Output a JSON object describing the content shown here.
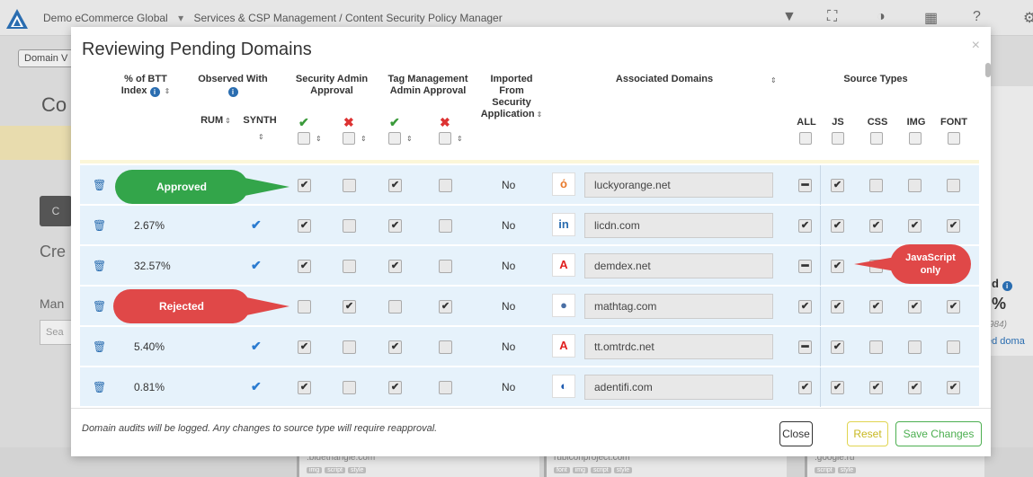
{
  "app": {
    "breadcrumb": [
      "Demo eCommerce Global",
      "Services & CSP Management / Content Security Policy Manager"
    ],
    "chip": "Domain V",
    "heading": "Co",
    "darkbtn": "C",
    "cre": "Cre",
    "man": "Man",
    "search_placeholder": "Sea",
    "right": {
      "t1": "d",
      "t2": "%",
      "t3": "984)",
      "t4": "ed doma"
    },
    "bottom_cards": [
      {
        "title": ".bluetriangle.com",
        "tags": [
          "img",
          "script",
          "style"
        ]
      },
      {
        "title": "rubiconproject.com",
        "tags": [
          "font",
          "img",
          "script",
          "style"
        ]
      },
      {
        "title": ".google.ru",
        "tags": [
          "script",
          "style"
        ]
      }
    ]
  },
  "modal": {
    "title": "Reviewing Pending Domains",
    "close_glyph": "×",
    "headers": {
      "btt_line1": "% of BTT",
      "btt_line2": "Index",
      "observed_with": "Observed With",
      "rum": "RUM",
      "synth": "SYNTH",
      "security_admin_line1": "Security Admin",
      "security_admin_line2": "Approval",
      "tag_mgmt_line1": "Tag Management",
      "tag_mgmt_line2": "Admin Approval",
      "imported_line1": "Imported",
      "imported_line2": "From",
      "imported_line3": "Security",
      "imported_line4": "Application",
      "associated_domains": "Associated Domains",
      "source_types": "Source Types",
      "all": "ALL",
      "js": "JS",
      "css": "CSS",
      "img": "IMG",
      "font": "FONT"
    },
    "rows": [
      {
        "btt": "",
        "synth": false,
        "sec_approve": true,
        "sec_reject": false,
        "tag_approve": true,
        "tag_reject": false,
        "imported": "No",
        "icon": "luckyorange-icon",
        "icon_glyph": "ό",
        "icon_color": "#e8792a",
        "domain": "luckyorange.net",
        "all": "dash",
        "js": true,
        "css": false,
        "img": false,
        "font": false
      },
      {
        "btt": "2.67%",
        "synth": true,
        "sec_approve": true,
        "sec_reject": false,
        "tag_approve": true,
        "tag_reject": false,
        "imported": "No",
        "icon": "linkedin-icon",
        "icon_glyph": "in",
        "icon_color": "#2a6db0",
        "domain": "licdn.com",
        "all": "check",
        "js": true,
        "css": true,
        "img": true,
        "font": true
      },
      {
        "btt": "32.57%",
        "synth": true,
        "sec_approve": true,
        "sec_reject": false,
        "tag_approve": true,
        "tag_reject": false,
        "imported": "No",
        "icon": "adobe-icon",
        "icon_glyph": "A",
        "icon_color": "#e02020",
        "domain": "demdex.net",
        "all": "dash",
        "js": true,
        "css": false,
        "img": false,
        "font": false
      },
      {
        "btt": "",
        "synth": false,
        "sec_approve": false,
        "sec_reject": true,
        "tag_approve": false,
        "tag_reject": true,
        "imported": "No",
        "icon": "mathtag-icon",
        "icon_glyph": "●",
        "icon_color": "#4a6fa5",
        "domain": "mathtag.com",
        "all": "check",
        "js": true,
        "css": true,
        "img": true,
        "font": true
      },
      {
        "btt": "5.40%",
        "synth": true,
        "sec_approve": true,
        "sec_reject": false,
        "tag_approve": true,
        "tag_reject": false,
        "imported": "No",
        "icon": "adobe-icon",
        "icon_glyph": "A",
        "icon_color": "#e02020",
        "domain": "tt.omtrdc.net",
        "all": "dash",
        "js": true,
        "css": false,
        "img": false,
        "font": false
      },
      {
        "btt": "0.81%",
        "synth": true,
        "sec_approve": true,
        "sec_reject": false,
        "tag_approve": true,
        "tag_reject": false,
        "imported": "No",
        "icon": "adentifi-icon",
        "icon_glyph": "◐",
        "icon_color": "#1e5bb0",
        "domain": "adentifi.com",
        "all": "check",
        "js": true,
        "css": true,
        "img": true,
        "font": true
      }
    ],
    "footer_note": "Domain audits will be logged. Any changes to source type will require reapproval.",
    "buttons": {
      "close": "Close",
      "reset": "Reset",
      "save": "Save Changes"
    }
  },
  "callouts": {
    "approved": "Approved",
    "rejected": "Rejected",
    "js_line1": "JavaScript",
    "js_line2": "only"
  },
  "colors": {
    "accent_blue": "#2a6db0",
    "approve_green": "#33a54a",
    "reject_red": "#e04848",
    "row_bg": "#e6f2fb"
  }
}
